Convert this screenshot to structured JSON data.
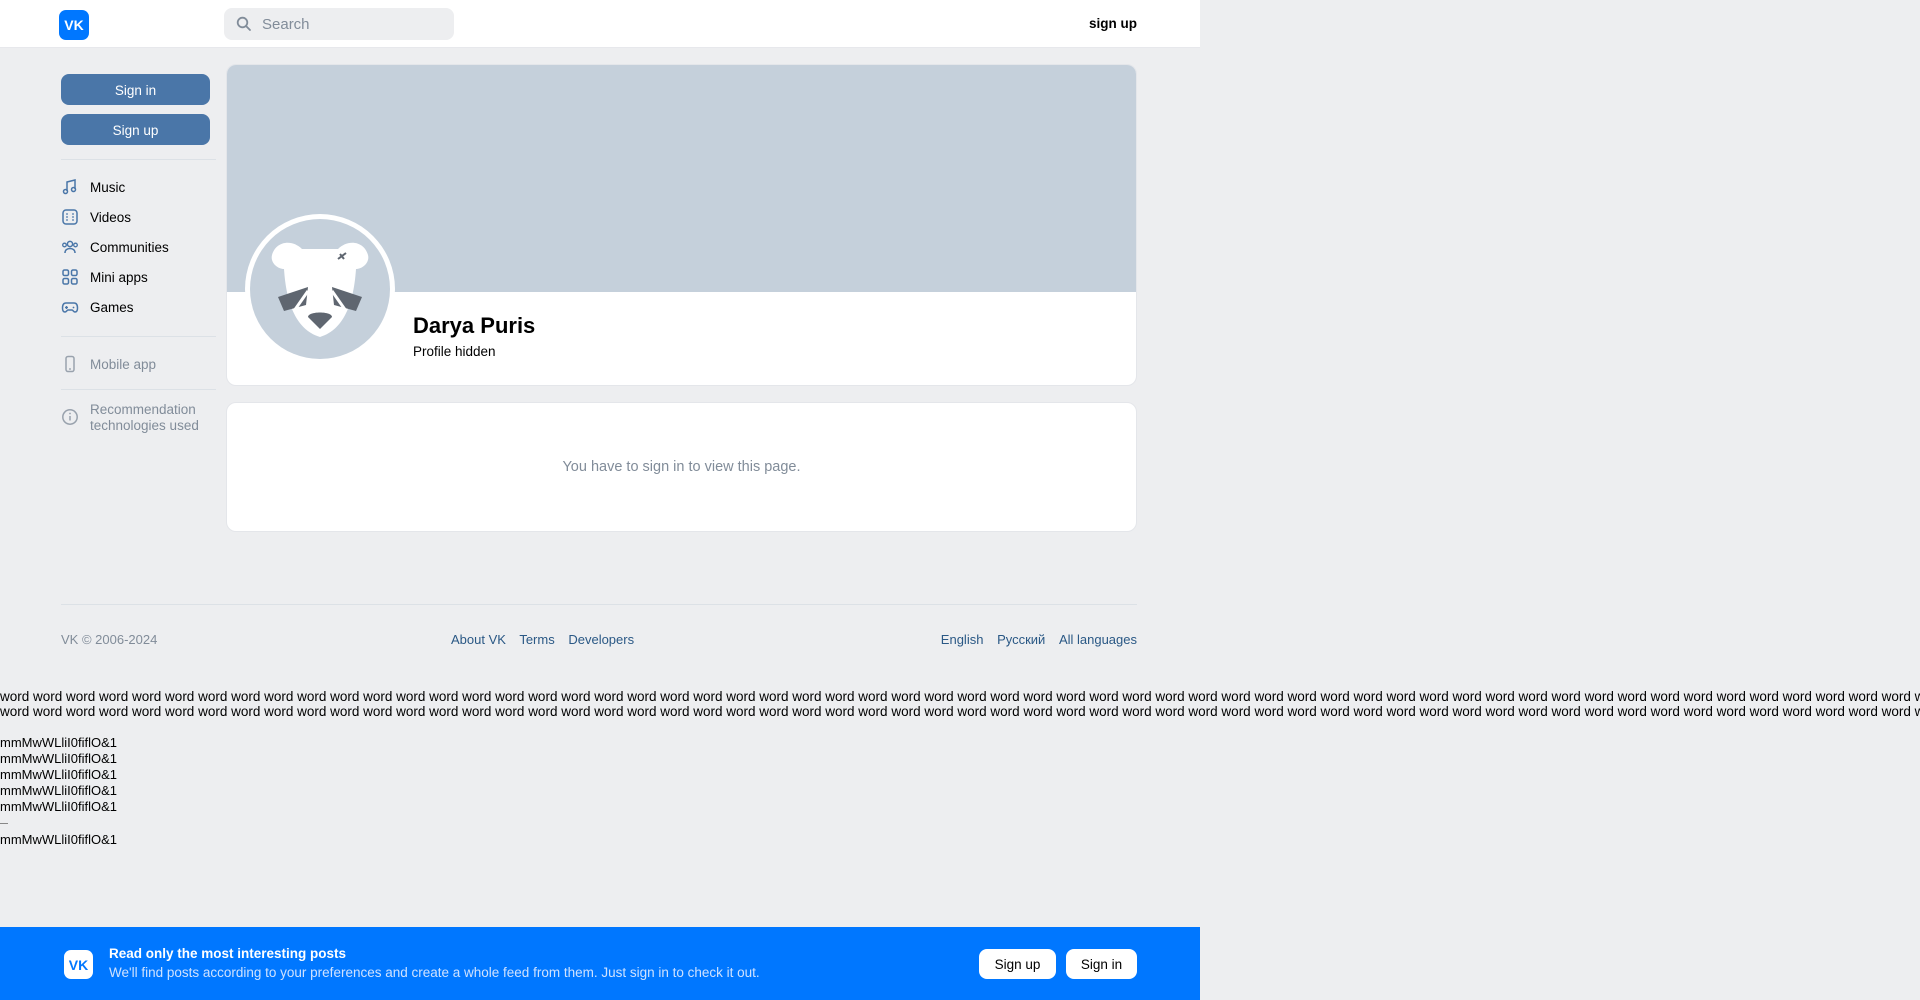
{
  "header": {
    "logo_text": "VK",
    "search_placeholder": "Search",
    "signup_label": "sign up"
  },
  "sidebar": {
    "signin_label": "Sign in",
    "signup_label": "Sign up",
    "items": [
      {
        "label": "Music",
        "icon": "music-note-icon"
      },
      {
        "label": "Videos",
        "icon": "video-icon"
      },
      {
        "label": "Communities",
        "icon": "communities-icon"
      },
      {
        "label": "Mini apps",
        "icon": "apps-grid-icon"
      },
      {
        "label": "Games",
        "icon": "gamepad-icon"
      }
    ],
    "mobile_app": "Mobile app",
    "recommendation_line1": "Recommendation",
    "recommendation_line2": "technologies used"
  },
  "profile": {
    "name": "Darya Puris",
    "status": "Profile hidden"
  },
  "locked": {
    "message": "You have to sign in to view this page."
  },
  "footer": {
    "copyright": "VK © 2006-2024",
    "links": [
      "About VK",
      "Terms",
      "Developers"
    ],
    "languages": [
      "English",
      "Русский",
      "All languages"
    ]
  },
  "test_text": {
    "word_line": "word word word word word word word word word word word word word word word word word word word word word word word word word word word word word word word word word word word word word word word word word word word word word word word word word word word word word word word word word word word word word word word word word word word word word word",
    "glyph_line": "mmMwWLliI0fiflO&1"
  },
  "banner": {
    "logo_text": "VK",
    "title": "Read only the most interesting posts",
    "text": "We'll find posts according to your preferences and create a whole feed from them. Just sign in to check it out.",
    "signup_label": "Sign up",
    "signin_label": "Sign in"
  },
  "colors": {
    "brand": "#0077ff",
    "button": "#4a76a8",
    "background": "#edeef0",
    "cover": "#c5d0db",
    "link": "#2a5885",
    "muted": "#818c99"
  }
}
